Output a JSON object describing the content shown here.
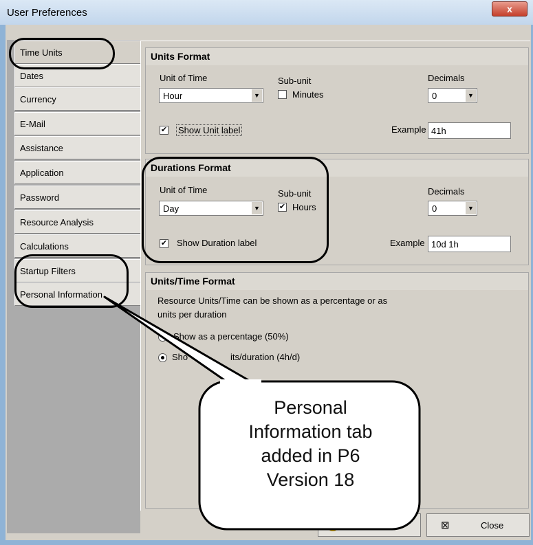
{
  "window": {
    "title": "User Preferences",
    "close_glyph": "x"
  },
  "tabs": [
    {
      "label": "Time Units"
    },
    {
      "label": "Dates"
    },
    {
      "label": "Currency"
    },
    {
      "label": "E-Mail"
    },
    {
      "label": "Assistance"
    },
    {
      "label": "Application"
    },
    {
      "label": "Password"
    },
    {
      "label": "Resource Analysis"
    },
    {
      "label": "Calculations"
    },
    {
      "label": "Startup Filters"
    },
    {
      "label": "Personal Information"
    }
  ],
  "units_format": {
    "heading": "Units Format",
    "unit_of_time_label": "Unit of Time",
    "unit_of_time_value": "Hour",
    "subunit_label": "Sub-unit",
    "subunit_option": "Minutes",
    "decimals_label": "Decimals",
    "decimals_value": "0",
    "show_label": "Show Unit label",
    "example_label": "Example",
    "example_value": "41h"
  },
  "durations_format": {
    "heading": "Durations Format",
    "unit_of_time_label": "Unit of Time",
    "unit_of_time_value": "Day",
    "subunit_label": "Sub-unit",
    "subunit_option": "Hours",
    "decimals_label": "Decimals",
    "decimals_value": "0",
    "show_label": "Show Duration label",
    "example_label": "Example",
    "example_value": "10d 1h"
  },
  "units_time_format": {
    "heading": "Units/Time Format",
    "description_line1": "Resource Units/Time can be shown as a percentage or as",
    "description_line2": "units per duration",
    "radio_percentage": "Show as a percentage (50%)",
    "radio_units_visible_start": "Sho",
    "radio_units_visible_end": "its/duration (4h/d)"
  },
  "footer": {
    "help_visible": "lp",
    "close_label": "Close"
  },
  "callout": {
    "lines": [
      "Personal",
      "Information tab",
      "added in P6",
      "Version 18"
    ]
  }
}
